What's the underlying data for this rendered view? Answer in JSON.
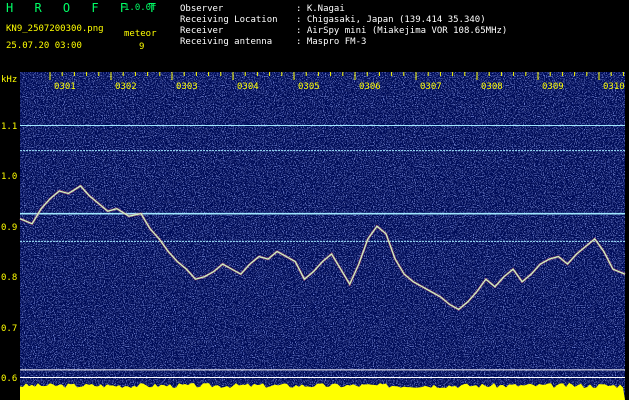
{
  "header": {
    "logo": "H R O F F T",
    "version": "1.0.0f",
    "filename": "KN9_2507200300.png",
    "datetime": "25.07.20 03:00",
    "meteor_label": "meteor",
    "meteor_count": "9",
    "info": [
      {
        "label": "Observer",
        "value": ": K.Nagai"
      },
      {
        "label": "Receiving Location",
        "value": ": Chigasaki, Japan (139.414 35.340)"
      },
      {
        "label": "Receiver",
        "value": ": AirSpy mini (Miakejima VOR 108.65MHz)"
      },
      {
        "label": "Receiving antenna",
        "value": ": Maspro FM-3"
      }
    ]
  },
  "axes": {
    "y_unit": "kHz",
    "y_ticks": [
      "1.1",
      "1.0",
      "0.9",
      "0.8",
      "0.7",
      "0.6"
    ],
    "x_ticks": [
      "0301",
      "0302",
      "0303",
      "0304",
      "0305",
      "0306",
      "0307",
      "0308",
      "0309",
      "0310"
    ]
  },
  "spectrogram": {
    "background_color": "#000a5a",
    "trace_color": "#c8ffc8",
    "line_color": "#a0e8ff",
    "bottom_bar_color": "#ffff00",
    "horizontal_lines_khz": [
      1.105,
      1.055,
      0.93,
      0.875,
      0.62,
      0.605
    ],
    "doppler_trace": [
      [
        0.0,
        0.92
      ],
      [
        0.02,
        0.91
      ],
      [
        0.035,
        0.94
      ],
      [
        0.05,
        0.96
      ],
      [
        0.065,
        0.975
      ],
      [
        0.08,
        0.97
      ],
      [
        0.1,
        0.985
      ],
      [
        0.115,
        0.965
      ],
      [
        0.13,
        0.95
      ],
      [
        0.145,
        0.935
      ],
      [
        0.16,
        0.94
      ],
      [
        0.18,
        0.925
      ],
      [
        0.2,
        0.93
      ],
      [
        0.215,
        0.9
      ],
      [
        0.23,
        0.88
      ],
      [
        0.245,
        0.855
      ],
      [
        0.26,
        0.835
      ],
      [
        0.275,
        0.82
      ],
      [
        0.29,
        0.8
      ],
      [
        0.305,
        0.805
      ],
      [
        0.32,
        0.815
      ],
      [
        0.335,
        0.83
      ],
      [
        0.35,
        0.82
      ],
      [
        0.365,
        0.81
      ],
      [
        0.38,
        0.83
      ],
      [
        0.395,
        0.845
      ],
      [
        0.41,
        0.84
      ],
      [
        0.425,
        0.855
      ],
      [
        0.44,
        0.845
      ],
      [
        0.455,
        0.835
      ],
      [
        0.47,
        0.8
      ],
      [
        0.485,
        0.815
      ],
      [
        0.5,
        0.835
      ],
      [
        0.515,
        0.85
      ],
      [
        0.53,
        0.82
      ],
      [
        0.545,
        0.79
      ],
      [
        0.56,
        0.83
      ],
      [
        0.575,
        0.88
      ],
      [
        0.59,
        0.905
      ],
      [
        0.605,
        0.89
      ],
      [
        0.62,
        0.84
      ],
      [
        0.635,
        0.81
      ],
      [
        0.65,
        0.795
      ],
      [
        0.665,
        0.785
      ],
      [
        0.68,
        0.775
      ],
      [
        0.695,
        0.765
      ],
      [
        0.71,
        0.75
      ],
      [
        0.725,
        0.74
      ],
      [
        0.74,
        0.755
      ],
      [
        0.755,
        0.775
      ],
      [
        0.77,
        0.8
      ],
      [
        0.785,
        0.785
      ],
      [
        0.8,
        0.805
      ],
      [
        0.815,
        0.82
      ],
      [
        0.83,
        0.795
      ],
      [
        0.845,
        0.81
      ],
      [
        0.86,
        0.83
      ],
      [
        0.875,
        0.84
      ],
      [
        0.89,
        0.845
      ],
      [
        0.905,
        0.83
      ],
      [
        0.92,
        0.85
      ],
      [
        0.935,
        0.865
      ],
      [
        0.95,
        0.88
      ],
      [
        0.965,
        0.855
      ],
      [
        0.98,
        0.82
      ],
      [
        1.0,
        0.81
      ]
    ]
  }
}
